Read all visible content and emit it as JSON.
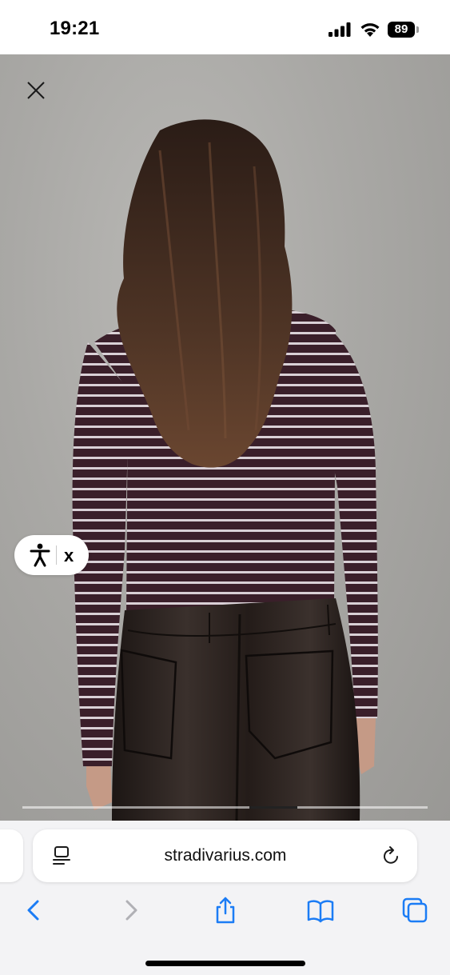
{
  "status_bar": {
    "time": "19:21",
    "battery_level": "89",
    "signal_icon": "cellular-signal-icon",
    "wifi_icon": "wifi-icon"
  },
  "product_gallery": {
    "close_icon": "close-icon",
    "image_description_icon": "model-back-view-photo",
    "progress_fraction": 0.62
  },
  "accessibility_widget": {
    "icon": "accessibility-person-icon",
    "close_label": "x"
  },
  "browser": {
    "url": "stradivarius.com",
    "reader_icon": "page-menu-icon",
    "reload_icon": "reload-icon",
    "toolbar": [
      "back-icon",
      "forward-icon",
      "share-icon",
      "bookmarks-icon",
      "tabs-icon"
    ]
  },
  "colors": {
    "accent_blue": "#1b7cf5",
    "disabled_gray": "#b0b0b5",
    "toolbar_bg": "#f3f3f5"
  }
}
